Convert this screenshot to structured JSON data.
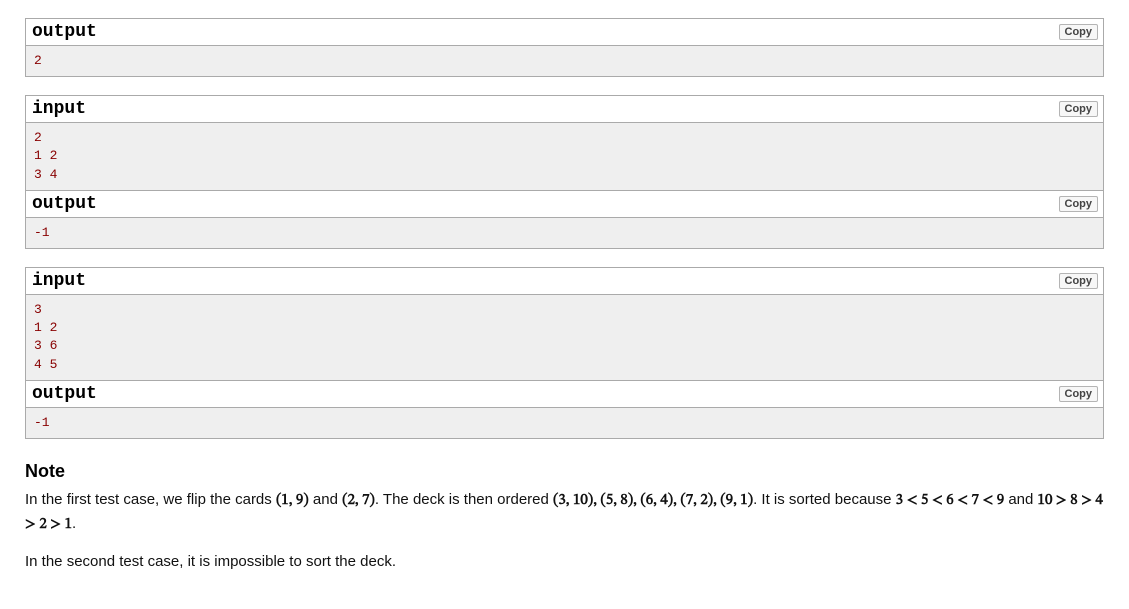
{
  "copyLabel": "Copy",
  "labels": {
    "input": "input",
    "output": "output",
    "note": "Note"
  },
  "blocks": [
    {
      "kind": "output",
      "joined": false,
      "content": "2"
    },
    {
      "kind": "input",
      "joined": false,
      "content": "2\n1 2\n3 4"
    },
    {
      "kind": "output",
      "joined": true,
      "content": "-1"
    },
    {
      "kind": "input",
      "joined": false,
      "content": "3\n1 2\n3 6\n4 5"
    },
    {
      "kind": "output",
      "joined": true,
      "content": "-1"
    }
  ],
  "note": {
    "p1_a": "In the first test case, we flip the cards ",
    "p1_m1": "(1, 9)",
    "p1_b": " and ",
    "p1_m2": "(2, 7)",
    "p1_c": ". The deck is then ordered ",
    "p1_m3": "(3, 10), (5, 8), (6, 4), (7, 2), (9, 1)",
    "p1_d": ". It is sorted because ",
    "p1_m4": "3 < 5 < 6 < 7 < 9",
    "p1_e": " and ",
    "p1_m5": "10 > 8 > 4 > 2 > 1",
    "p1_f": ".",
    "p2": "In the second test case, it is impossible to sort the deck."
  }
}
